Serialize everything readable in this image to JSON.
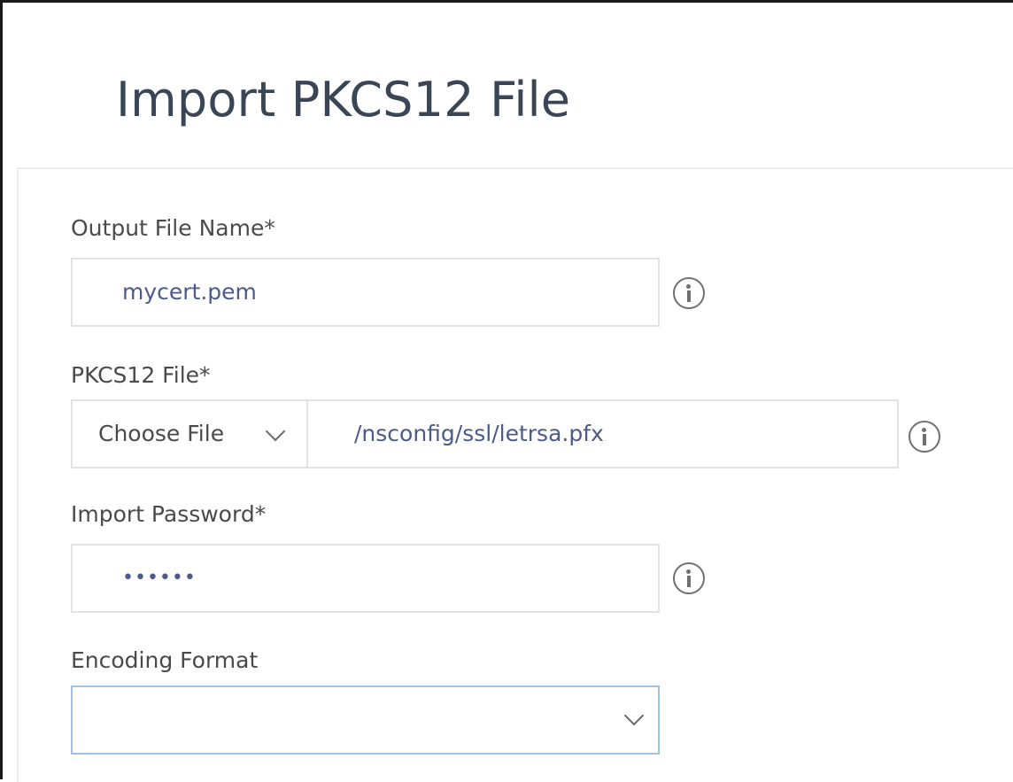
{
  "dialog": {
    "title": "Import PKCS12 File"
  },
  "fields": {
    "output_file_name": {
      "label": "Output File Name*",
      "value": "mycert.pem"
    },
    "pkcs12_file": {
      "label": "PKCS12 File*",
      "source_option": "Choose File",
      "value": "/nsconfig/ssl/letrsa.pfx"
    },
    "import_password": {
      "label": "Import Password*",
      "masked_value": "••••••"
    },
    "encoding_format": {
      "label": "Encoding Format",
      "value": ""
    }
  },
  "icons": {
    "info": "info-icon",
    "dropdown": "chevron-down-icon"
  },
  "colors": {
    "title": "#3a4656",
    "label": "#4a4a4a",
    "input_value": "#4d5a8a",
    "input_border": "#dfe3e8",
    "focused_border": "#9ec1ea",
    "icon": "#707070"
  }
}
